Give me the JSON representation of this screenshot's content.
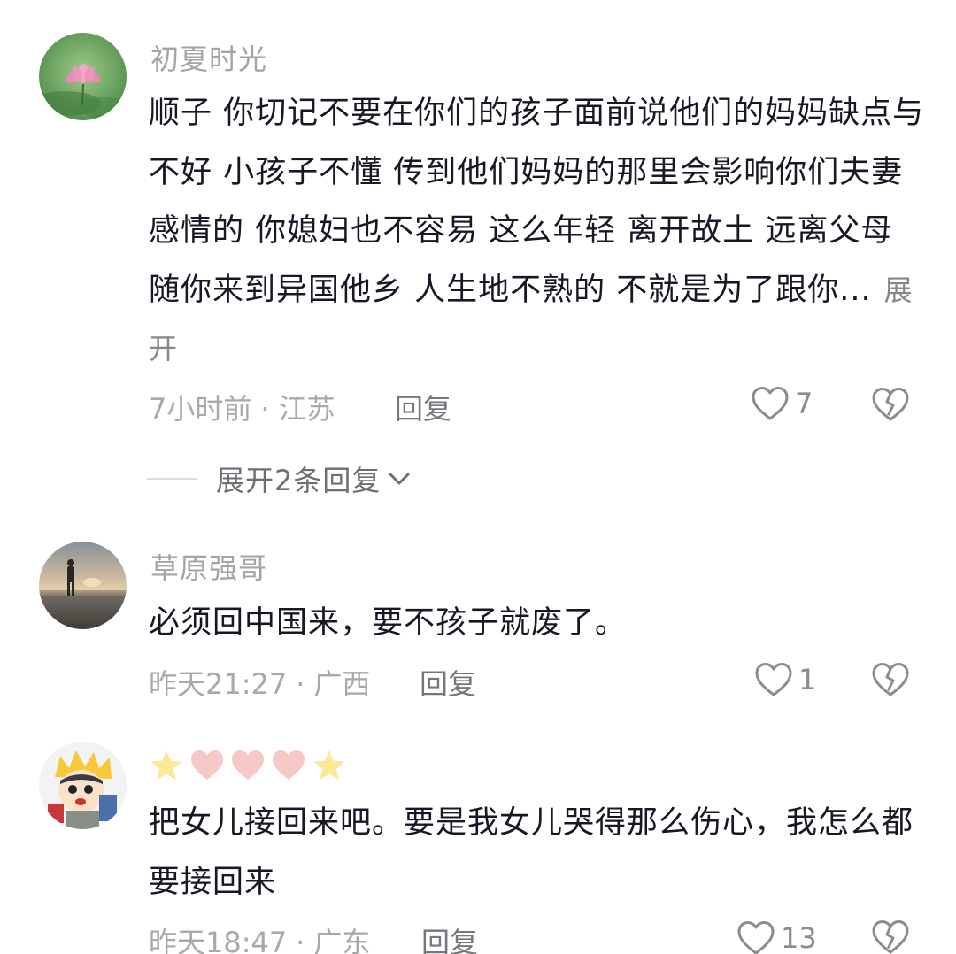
{
  "comments": [
    {
      "username": "初夏时光",
      "text": "顺子  你切记不要在你们的孩子面前说他们的妈妈缺点与不好  小孩子不懂  传到他们妈妈的那里会影响你们夫妻感情的  你媳妇也不容易  这么年轻 离开故土 远离父母 随你来到异国他乡 人生地不熟的  不就是为了跟你...",
      "expand_label": "展开",
      "time": "7小时前",
      "location": "江苏",
      "reply_label": "回复",
      "likes": "7",
      "expand_replies_label": "展开2条回复",
      "avatar_icon": "lotus-flower-avatar"
    },
    {
      "username": "草原强哥",
      "text": "必须回中国来，要不孩子就废了。",
      "time": "昨天21:27",
      "location": "广西",
      "reply_label": "回复",
      "likes": "1",
      "avatar_icon": "sunset-beach-avatar"
    },
    {
      "username_emojis": [
        "star",
        "pink-heart",
        "pink-heart",
        "pink-heart",
        "star"
      ],
      "text": "把女儿接回来吧。要是我女儿哭得那么伤心，我怎么都要接回来",
      "time": "昨天18:47",
      "location": "广东",
      "reply_label": "回复",
      "likes": "13",
      "avatar_icon": "cartoon-boy-avatar"
    }
  ],
  "separator_dot": "·",
  "colors": {
    "text": "#161823",
    "muted": "#a8a8ad",
    "star": "#fde89a",
    "heart": "#f7c9c6"
  }
}
